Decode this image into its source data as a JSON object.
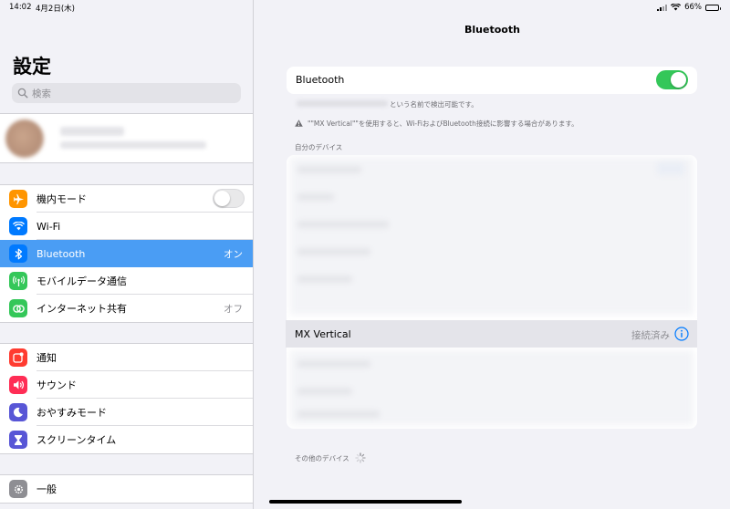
{
  "status": {
    "time": "14:02",
    "date": "4月2日(木)",
    "battery": "66%",
    "battery_level": 0.66
  },
  "sidebar": {
    "title": "設定",
    "search_placeholder": "検索",
    "group1": [
      {
        "label": "機内モード",
        "icon": "airplane-icon",
        "color": "#ff9500",
        "toggle": false
      },
      {
        "label": "Wi-Fi",
        "icon": "wifi-icon",
        "color": "#007aff",
        "value": ""
      },
      {
        "label": "Bluetooth",
        "icon": "bluetooth-icon",
        "color": "#007aff",
        "value": "オン",
        "selected": true
      },
      {
        "label": "モバイルデータ通信",
        "icon": "antenna-icon",
        "color": "#34c759",
        "value": ""
      },
      {
        "label": "インターネット共有",
        "icon": "hotspot-icon",
        "color": "#34c759",
        "value": "オフ"
      }
    ],
    "group2": [
      {
        "label": "通知",
        "icon": "notifications-icon",
        "color": "#ff3b30"
      },
      {
        "label": "サウンド",
        "icon": "sound-icon",
        "color": "#ff2d55"
      },
      {
        "label": "おやすみモード",
        "icon": "moon-icon",
        "color": "#5856d6"
      },
      {
        "label": "スクリーンタイム",
        "icon": "hourglass-icon",
        "color": "#5856d6"
      }
    ],
    "group3": [
      {
        "label": "一般",
        "icon": "gear-icon",
        "color": "#8e8e93"
      }
    ]
  },
  "main": {
    "title": "Bluetooth",
    "bluetooth_label": "Bluetooth",
    "bluetooth_on": true,
    "discoverable_text": "という名前で検出可能です。",
    "warning_text": "\"\"MX Vertical\"\"を使用すると、Wi-FiおよびBluetooth接続に影響する場合があります。",
    "my_devices_label": "自分のデバイス",
    "connected_device": {
      "name": "MX Vertical",
      "status": "接続済み"
    },
    "other_devices_label": "その他のデバイス"
  },
  "colors": {
    "accent": "#4a9df4",
    "toggle_on": "#34c759",
    "info": "#007aff"
  }
}
